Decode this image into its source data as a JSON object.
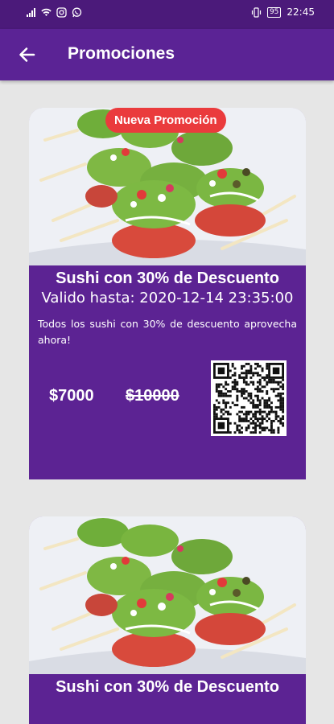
{
  "status_bar": {
    "time": "22:45",
    "battery": "95",
    "icons": [
      "signal-icon",
      "wifi-icon",
      "instagram-icon",
      "whatsapp-icon",
      "vibrate-icon",
      "battery-icon"
    ]
  },
  "app_bar": {
    "title": "Promociones",
    "back_icon": "arrow-back-icon"
  },
  "colors": {
    "primary": "#5b2395",
    "status_bar": "#4b1a7a",
    "badge": "#ea3b3d",
    "background": "#e6e6e6"
  },
  "promotions": [
    {
      "badge": "Nueva Promoción",
      "title": "Sushi con 30% de Descuento",
      "valid_until": "Valido hasta: 2020-12-14 23:35:00",
      "description": "Todos los sushi con 30% de descuento aprovecha ahora!",
      "price": "$7000",
      "old_price": "$10000",
      "qr_icon": "qr-code-icon"
    },
    {
      "title": "Sushi con 30% de Descuento"
    }
  ]
}
